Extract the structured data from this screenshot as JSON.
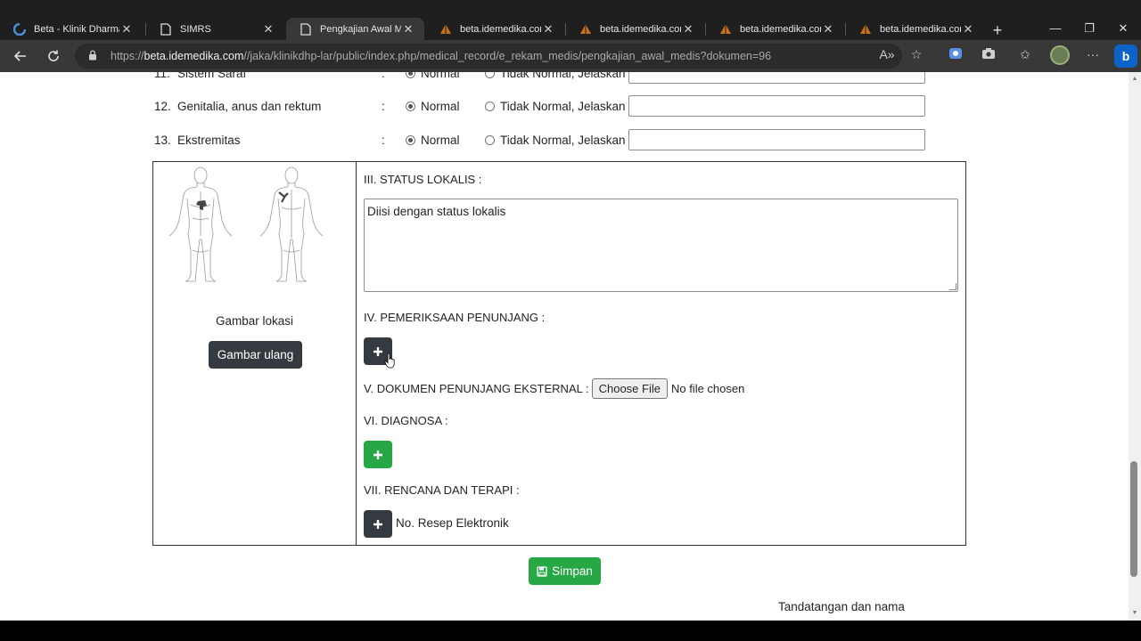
{
  "browser": {
    "tabs": [
      {
        "title": "Beta - Klinik Dharmahu",
        "icon": "swirl-icon",
        "active": false
      },
      {
        "title": "SIMRS",
        "icon": "page-icon",
        "active": false
      },
      {
        "title": "Pengkajian Awal Medis",
        "icon": "page-icon",
        "active": true
      },
      {
        "title": "beta.idemedika.com / l",
        "icon": "sailboat-icon",
        "active": false
      },
      {
        "title": "beta.idemedika.com / l",
        "icon": "sailboat-icon",
        "active": false
      },
      {
        "title": "beta.idemedika.com / l",
        "icon": "sailboat-icon",
        "active": false
      },
      {
        "title": "beta.idemedika.com / l",
        "icon": "sailboat-icon",
        "active": false
      }
    ],
    "url_prefix": "https://",
    "url_host": "beta.idemedika.com",
    "url_path": "//jaka/klinikdhp-lar/public/index.php/medical_record/e_rekam_medis/pengkajian_awal_medis?dokumen=96"
  },
  "exam": {
    "rows": [
      {
        "num": "11.",
        "label": "Sistem Saraf",
        "colon": ":",
        "normal": "Normal",
        "abnormal": "Tidak Normal, Jelaskan :",
        "value": ""
      },
      {
        "num": "12.",
        "label": "Genitalia, anus dan rektum",
        "colon": ":",
        "normal": "Normal",
        "abnormal": "Tidak Normal, Jelaskan :",
        "value": ""
      },
      {
        "num": "13.",
        "label": "Ekstremitas",
        "colon": ":",
        "normal": "Normal",
        "abnormal": "Tidak Normal, Jelaskan :",
        "value": ""
      }
    ]
  },
  "left_panel": {
    "caption": "Gambar lokasi",
    "redraw_button": "Gambar ulang"
  },
  "sections": {
    "status_lokalis_title": "III. STATUS LOKALIS :",
    "status_lokalis_value": "Diisi dengan status lokalis",
    "penunjang_title": "IV. PEMERIKSAAN PENUNJANG :",
    "dokumen_title": "V. DOKUMEN PENUNJANG EKSTERNAL :",
    "choose_file": "Choose File",
    "no_file": "No file chosen",
    "diagnosa_title": "VI. DIAGNOSA :",
    "rencana_title": "VII. RENCANA DAN TERAPI :",
    "resep_label": "No. Resep Elektronik"
  },
  "footer": {
    "save_button": "Simpan",
    "signature_label": "Tandatangan dan nama"
  },
  "colors": {
    "dark_button": "#343a40",
    "green_button": "#28a745"
  }
}
